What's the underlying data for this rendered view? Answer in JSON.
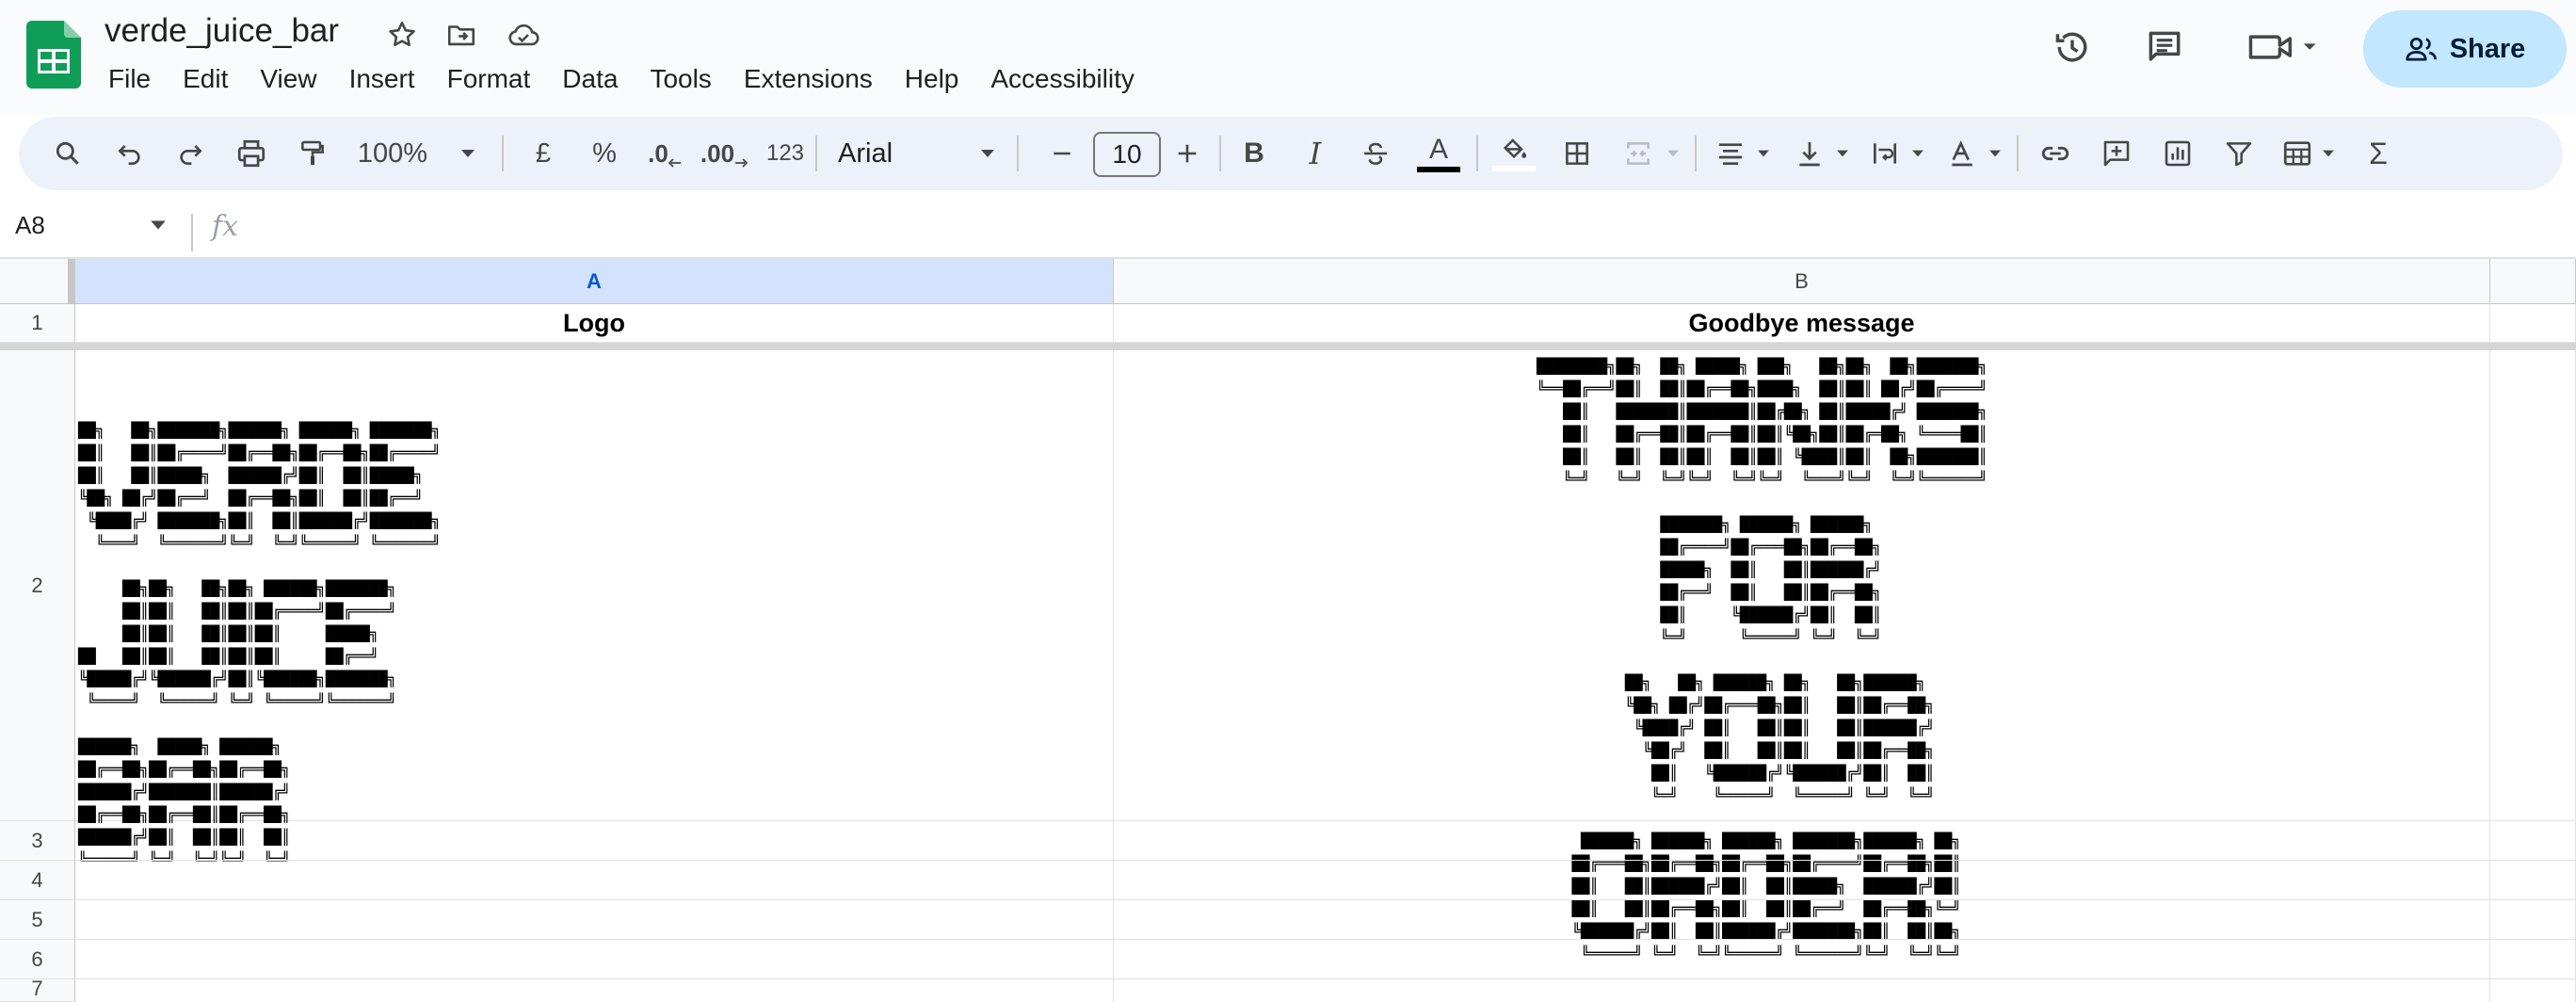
{
  "app": {
    "doc_title": "verde_juice_bar",
    "menu": [
      "File",
      "Edit",
      "View",
      "Insert",
      "Format",
      "Data",
      "Tools",
      "Extensions",
      "Help",
      "Accessibility"
    ],
    "share_label": "Share",
    "accent": "#c2e7ff"
  },
  "toolbar": {
    "zoom": "100%",
    "currency": "£",
    "percent": "%",
    "decrease_decimals": ".0",
    "increase_decimals": ".00",
    "number_format": "123",
    "font": "Arial",
    "font_size": "10",
    "icons": [
      "search-icon",
      "undo-icon",
      "redo-icon",
      "print-icon",
      "paint-format-icon",
      "bold-icon",
      "italic-icon",
      "strikethrough-icon",
      "text-color-icon",
      "fill-color-icon",
      "borders-icon",
      "merge-cells-icon",
      "horizontal-align-icon",
      "vertical-align-icon",
      "text-wrapping-icon",
      "text-rotation-icon",
      "link-icon",
      "comment-icon",
      "chart-icon",
      "filter-icon",
      "table-icon",
      "functions-icon"
    ]
  },
  "formula_bar": {
    "cell_ref": "A8",
    "fx": "fx",
    "content": ""
  },
  "grid": {
    "columns": [
      "A",
      "B"
    ],
    "rows": [
      "1",
      "2",
      "3",
      "4",
      "5",
      "6",
      "7"
    ],
    "cells": {
      "A1": "Logo",
      "B1": "Goodbye message",
      "A2": "██╗   ██╗███████╗██████╗ ██████╗ ███████╗\n██║   ██║██╔════╝██╔══██╗██╔══██╗██╔════╝\n██║   ██║█████╗  ██████╔╝██║  ██║█████╗  \n╚██╗ ██╔╝██╔══╝  ██╔══██╗██║  ██║██╔══╝  \n ╚████╔╝ ███████╗██║  ██║██████╔╝███████╗\n  ╚═══╝  ╚══════╝╚═╝  ╚═╝╚═════╝ ╚══════╝\n\n     ██╗██╗   ██╗██╗ ██████╗███████╗\n     ██║██║   ██║██║██╔════╝██╔════╝\n     ██║██║   ██║██║██║     █████╗  \n██   ██║██║   ██║██║██║     ██╔══╝  \n╚█████╔╝╚██████╔╝██║╚██████╗███████╗\n ╚════╝  ╚═════╝ ╚═╝ ╚═════╝╚══════╝\n\n██████╗  █████╗ ██████╗ \n██╔══██╗██╔══██╗██╔══██╗\n██████╔╝███████║██████╔╝\n██╔══██╗██╔══██║██╔══██╗\n██████╔╝██║  ██║██║  ██║\n╚═════╝ ╚═╝  ╚═╝╚═╝  ╚═╝",
      "B2": "████████╗██╗  ██╗ █████╗ ███╗   ██╗██╗  ██╗███████╗\n╚══██╔══╝██║  ██║██╔══██╗████╗  ██║██║ ██╔╝██╔════╝\n   ██║   ███████║███████║██╔██╗ ██║█████╔╝ ███████╗\n   ██║   ██╔══██║██╔══██║██║╚██╗██║██╔═██╗ ╚════██║\n   ██║   ██║  ██║██║  ██║██║ ╚████║██║  ██╗███████║\n   ╚═╝   ╚═╝  ╚═╝╚═╝  ╚═╝╚═╝  ╚═══╝╚═╝  ╚═╝╚══════╝\n\n              ███████╗ ██████╗ ██████╗ \n              ██╔════╝██╔═══██╗██╔══██╗\n              █████╗  ██║   ██║██████╔╝\n              ██╔══╝  ██║   ██║██╔══██╗\n              ██║     ╚██████╔╝██║  ██║\n              ╚═╝      ╚═════╝ ╚═╝  ╚═╝\n\n          ██╗   ██╗ ██████╗ ██╗   ██╗██████╗ \n          ╚██╗ ██╔╝██╔═══██╗██║   ██║██╔══██╗\n           ╚████╔╝ ██║   ██║██║   ██║██████╔╝\n            ╚██╔╝  ██║   ██║██║   ██║██╔══██╗\n             ██║   ╚██████╔╝╚██████╔╝██║  ██║\n             ╚═╝    ╚═════╝  ╚═════╝ ╚═╝  ╚═╝\n\n     ██████╗ ██████╗ ██████╗ ███████╗██████╗ ██╗\n    ██╔═══██╗██╔══██╗██╔══██╗██╔════╝██╔══██╗██║\n    ██║   ██║██████╔╝██║  ██║█████╗  ██████╔╝██║\n    ██║   ██║██╔══██╗██║  ██║██╔══╝  ██╔══██╗╚═╝\n    ╚██████╔╝██║  ██║██████╔╝███████╗██║  ██║██╗\n     ╚═════╝ ╚═╝  ╚═╝╚═════╝ ╚══════╝╚═╝  ╚═╝╚═╝"
    }
  }
}
